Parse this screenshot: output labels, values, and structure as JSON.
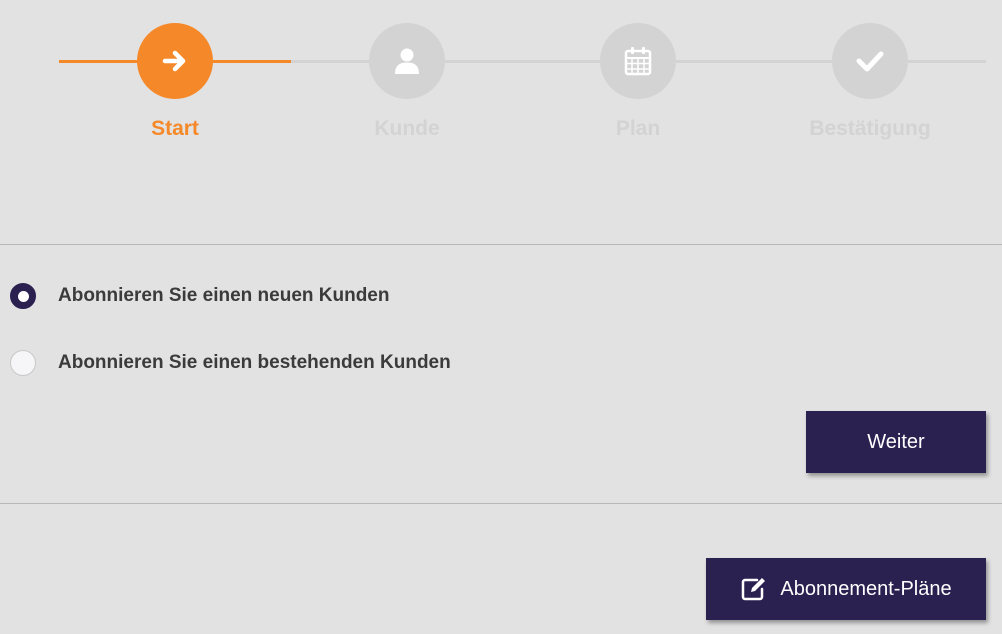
{
  "stepper": {
    "steps": [
      {
        "label": "Start",
        "icon": "arrow-right-icon",
        "state": "active"
      },
      {
        "label": "Kunde",
        "icon": "user-icon",
        "state": "inactive"
      },
      {
        "label": "Plan",
        "icon": "calendar-icon",
        "state": "inactive"
      },
      {
        "label": "Bestätigung",
        "icon": "checkmark-icon",
        "state": "inactive"
      }
    ]
  },
  "options": {
    "items": [
      {
        "label": "Abonnieren Sie einen neuen Kunden",
        "checked": true
      },
      {
        "label": "Abonnieren Sie einen bestehenden Kunden",
        "checked": false
      }
    ]
  },
  "actions": {
    "next_label": "Weiter"
  },
  "footer": {
    "plans_label": "Abonnement-Pläne",
    "plans_icon": "edit-icon"
  },
  "colors": {
    "accent": "#f5892a",
    "primary": "#2a2150",
    "inactive": "#d3d3d3",
    "background": "#e2e2e2"
  }
}
